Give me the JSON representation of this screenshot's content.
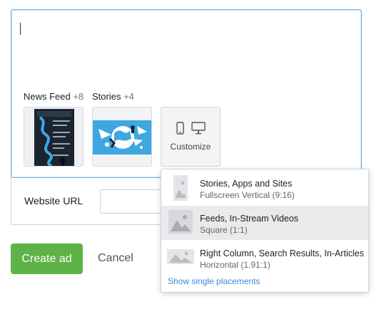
{
  "editor": {
    "text": "",
    "placements": [
      {
        "label": "News Feed",
        "count": "+8"
      },
      {
        "label": "Stories",
        "count": "+4"
      }
    ],
    "customize_label": "Customize"
  },
  "website": {
    "label": "Website URL",
    "value": ""
  },
  "actions": {
    "create_label": "Create ad",
    "cancel_label": "Cancel"
  },
  "dropdown": {
    "items": [
      {
        "title": "Stories, Apps and Sites",
        "subtitle": "Fullscreen Vertical (9:16)",
        "icon": "vertical-image-icon",
        "selected": false
      },
      {
        "title": "Feeds, In-Stream Videos",
        "subtitle": "Square (1:1)",
        "icon": "square-image-icon",
        "selected": true
      },
      {
        "title": "Right Column, Search Results, In-Articles",
        "subtitle": "Horizontal (1.91:1)",
        "icon": "horizontal-image-icon",
        "selected": false
      }
    ],
    "link": "Show single placements"
  },
  "colors": {
    "accent_blue": "#62aee6",
    "create_green": "#5eb247",
    "link_blue": "#3b87d8",
    "selected_bg": "#e9eaec"
  }
}
